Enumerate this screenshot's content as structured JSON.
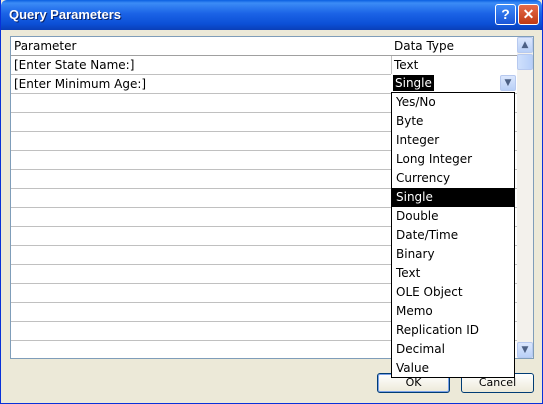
{
  "window": {
    "title": "Query Parameters",
    "help_glyph": "?",
    "close_glyph": "✕"
  },
  "grid": {
    "headers": [
      "Parameter",
      "Data Type"
    ],
    "rows": [
      {
        "parameter": "[Enter State Name:]",
        "data_type": "Text"
      },
      {
        "parameter": "[Enter Minimum Age:]",
        "data_type": "Single"
      }
    ]
  },
  "combo": {
    "value": "Single",
    "arrow_icon": "chevron-down-icon"
  },
  "dropdown": {
    "options": [
      "Yes/No",
      "Byte",
      "Integer",
      "Long Integer",
      "Currency",
      "Single",
      "Double",
      "Date/Time",
      "Binary",
      "Text",
      "OLE Object",
      "Memo",
      "Replication ID",
      "Decimal",
      "Value"
    ],
    "selected": "Single"
  },
  "buttons": {
    "ok": "OK",
    "cancel": "Cancel"
  },
  "colors": {
    "titlebar": "#0a5fe0",
    "dialog_bg": "#ece9d8",
    "selection": "#000000"
  }
}
